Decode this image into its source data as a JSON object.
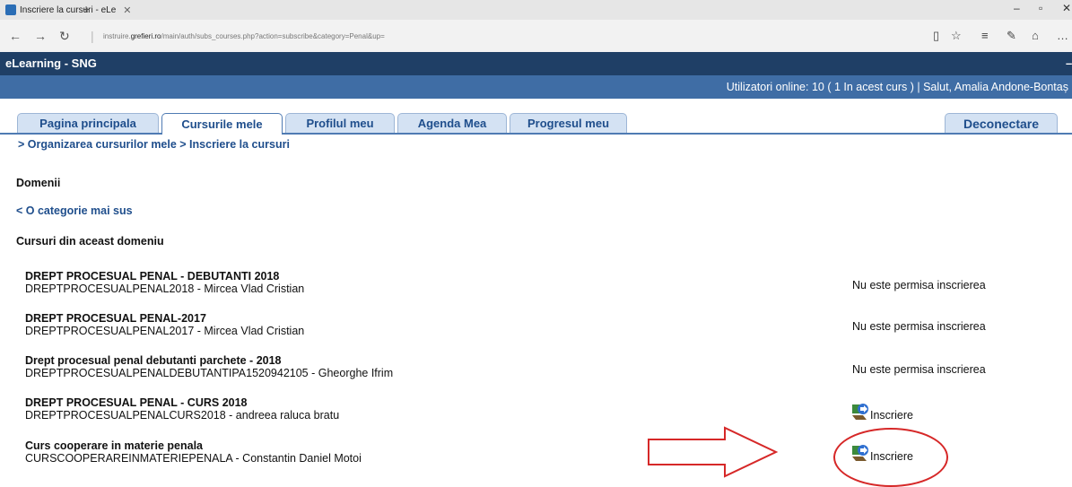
{
  "browser": {
    "tab_title": "Inscriere la cursuri - eLe",
    "new_tab": "+",
    "url_prefix": "instruire.",
    "url_domain": "grefieri.ro",
    "url_rest": "/main/auth/subs_courses.php?action=subscribe&category=Penal&up="
  },
  "site": {
    "brand": "eLearning - SNG",
    "online_text": "Utilizatori online:  10  ( 1 In acest curs  ) | Salut, Amalia Andone-Bontaș"
  },
  "tabs": [
    {
      "label": "Pagina principala"
    },
    {
      "label": "Cursurile mele"
    },
    {
      "label": "Profilul meu"
    },
    {
      "label": "Agenda Mea"
    },
    {
      "label": "Progresul meu"
    }
  ],
  "logout_label": "Deconectare",
  "breadcrumb": "> Organizarea cursurilor mele > Inscriere la cursuri",
  "domains_label": "Domenii",
  "up_link": "< O categorie mai sus",
  "courses_heading": "Cursuri din aceast domeniu",
  "courses": [
    {
      "title": "DREPT PROCESUAL PENAL - DEBUTANTI 2018",
      "subtitle": "DREPTPROCESUALPENAL2018 - Mircea Vlad Cristian",
      "status": "Nu este permisa inscrierea"
    },
    {
      "title": "DREPT PROCESUAL PENAL-2017",
      "subtitle": "DREPTPROCESUALPENAL2017 - Mircea Vlad Cristian",
      "status": "Nu este permisa inscrierea"
    },
    {
      "title": "Drept procesual penal debutanti parchete - 2018",
      "subtitle": "DREPTPROCESUALPENALDEBUTANTIPA1520942105 - Gheorghe Ifrim",
      "status": "Nu este permisa inscrierea"
    },
    {
      "title": "DREPT PROCESUAL PENAL - CURS 2018",
      "subtitle": "DREPTPROCESUALPENALCURS2018 - andreea raluca bratu",
      "action": "Inscriere"
    },
    {
      "title": "Curs cooperare in materie penala",
      "subtitle": "CURSCOOPERAREINMATERIEPENALA - Constantin Daniel Motoi",
      "action": "Inscriere"
    }
  ],
  "colors": {
    "brand_bar": "#1f3f66",
    "status_bar": "#3f6da5",
    "link": "#1f4e8c",
    "annotation": "#d62828"
  }
}
